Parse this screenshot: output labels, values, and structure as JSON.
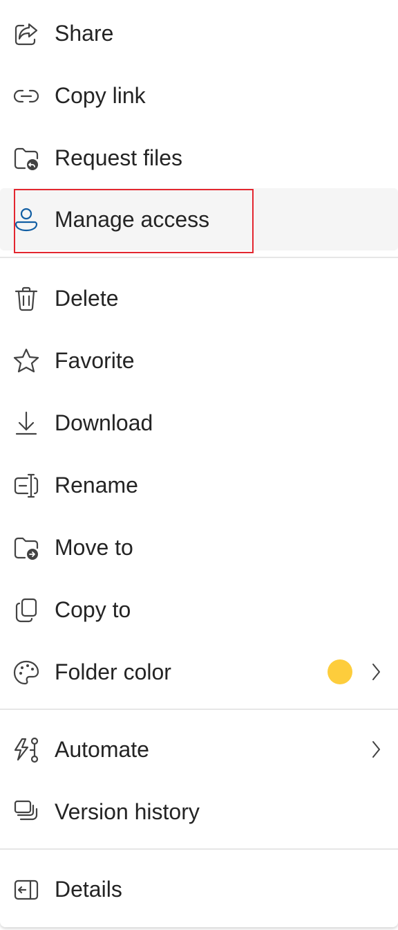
{
  "menu": {
    "items": [
      {
        "label": "Share",
        "icon": "share-icon"
      },
      {
        "label": "Copy link",
        "icon": "link-icon"
      },
      {
        "label": "Request files",
        "icon": "folder-request-icon"
      },
      {
        "label": "Manage access",
        "icon": "person-icon"
      },
      {
        "label": "Delete",
        "icon": "trash-icon"
      },
      {
        "label": "Favorite",
        "icon": "star-icon"
      },
      {
        "label": "Download",
        "icon": "download-icon"
      },
      {
        "label": "Rename",
        "icon": "rename-icon"
      },
      {
        "label": "Move to",
        "icon": "folder-move-icon"
      },
      {
        "label": "Copy to",
        "icon": "copy-icon"
      },
      {
        "label": "Folder color",
        "icon": "palette-icon"
      },
      {
        "label": "Automate",
        "icon": "automate-icon"
      },
      {
        "label": "Version history",
        "icon": "history-icon"
      },
      {
        "label": "Details",
        "icon": "details-icon"
      }
    ],
    "hovered_item": "Manage access",
    "folder_color_value": "#fdcd3c"
  },
  "colors": {
    "text": "#242424",
    "icon": "#424242",
    "accent_icon": "#115ea3",
    "hover_bg": "#f5f5f5",
    "highlight_border": "#e3262f"
  }
}
